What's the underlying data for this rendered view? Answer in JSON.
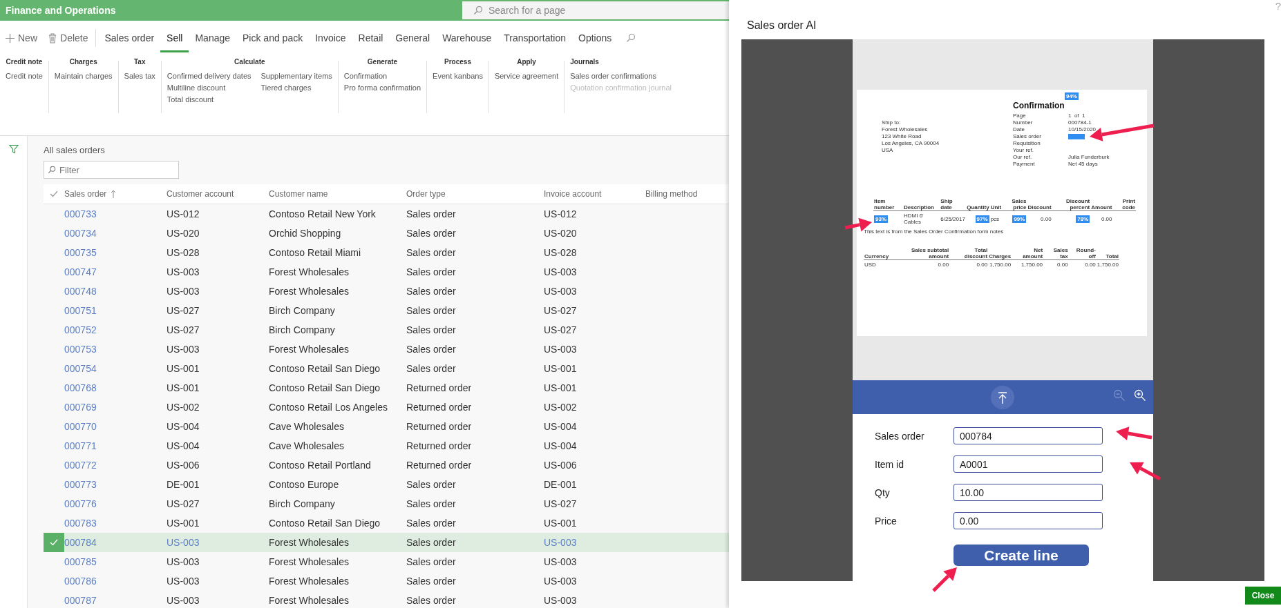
{
  "app": {
    "title": "Finance and Operations",
    "search_placeholder": "Search for a page"
  },
  "actions": [
    {
      "kind": "new",
      "label": "New"
    },
    {
      "kind": "delete",
      "label": "Delete"
    }
  ],
  "tabs": [
    {
      "label": "Sales order",
      "selected": false
    },
    {
      "label": "Sell",
      "selected": true
    },
    {
      "label": "Manage",
      "selected": false
    },
    {
      "label": "Pick and pack",
      "selected": false
    },
    {
      "label": "Invoice",
      "selected": false
    },
    {
      "label": "Retail",
      "selected": false
    },
    {
      "label": "General",
      "selected": false
    },
    {
      "label": "Warehouse",
      "selected": false
    },
    {
      "label": "Transportation",
      "selected": false
    },
    {
      "label": "Options",
      "selected": false
    }
  ],
  "ribbon": [
    {
      "title": "Credit note",
      "columns": [
        [
          {
            "label": "Credit note",
            "disabled": false
          }
        ]
      ]
    },
    {
      "title": "Charges",
      "columns": [
        [
          {
            "label": "Maintain charges",
            "disabled": false
          }
        ]
      ]
    },
    {
      "title": "Tax",
      "columns": [
        [
          {
            "label": "Sales tax",
            "disabled": false
          }
        ]
      ]
    },
    {
      "title": "Calculate",
      "columns": [
        [
          {
            "label": "Confirmed delivery dates",
            "disabled": false
          },
          {
            "label": "Multiline discount",
            "disabled": false
          },
          {
            "label": "Total discount",
            "disabled": false
          }
        ],
        [
          {
            "label": "Supplementary items",
            "disabled": false
          },
          {
            "label": "Tiered charges",
            "disabled": false
          }
        ]
      ]
    },
    {
      "title": "Generate",
      "columns": [
        [
          {
            "label": "Confirmation",
            "disabled": false
          },
          {
            "label": "Pro forma confirmation",
            "disabled": false
          }
        ]
      ]
    },
    {
      "title": "Process",
      "columns": [
        [
          {
            "label": "Event kanbans",
            "disabled": false
          }
        ]
      ]
    },
    {
      "title": "Apply",
      "columns": [
        [
          {
            "label": "Service agreement",
            "disabled": false
          }
        ]
      ]
    },
    {
      "title": "Journals",
      "columns": [
        [
          {
            "label": "Sales order confirmations",
            "disabled": false
          },
          {
            "label": "Quotation confirmation journal",
            "disabled": true
          }
        ]
      ]
    }
  ],
  "grid": {
    "title": "All sales orders",
    "filter_placeholder": "Filter",
    "columns": [
      "Sales order",
      "Customer account",
      "Customer name",
      "Order type",
      "Invoice account",
      "Billing method"
    ],
    "rows": [
      {
        "order": "000733",
        "account": "US-012",
        "name": "Contoso Retail New York",
        "type": "Sales order",
        "invoice": "US-012",
        "selected": false
      },
      {
        "order": "000734",
        "account": "US-020",
        "name": "Orchid Shopping",
        "type": "Sales order",
        "invoice": "US-020",
        "selected": false
      },
      {
        "order": "000735",
        "account": "US-028",
        "name": "Contoso Retail Miami",
        "type": "Sales order",
        "invoice": "US-028",
        "selected": false
      },
      {
        "order": "000747",
        "account": "US-003",
        "name": "Forest Wholesales",
        "type": "Sales order",
        "invoice": "US-003",
        "selected": false
      },
      {
        "order": "000748",
        "account": "US-003",
        "name": "Forest Wholesales",
        "type": "Sales order",
        "invoice": "US-003",
        "selected": false
      },
      {
        "order": "000751",
        "account": "US-027",
        "name": "Birch Company",
        "type": "Sales order",
        "invoice": "US-027",
        "selected": false
      },
      {
        "order": "000752",
        "account": "US-027",
        "name": "Birch Company",
        "type": "Sales order",
        "invoice": "US-027",
        "selected": false
      },
      {
        "order": "000753",
        "account": "US-003",
        "name": "Forest Wholesales",
        "type": "Sales order",
        "invoice": "US-003",
        "selected": false
      },
      {
        "order": "000754",
        "account": "US-001",
        "name": "Contoso Retail San Diego",
        "type": "Sales order",
        "invoice": "US-001",
        "selected": false
      },
      {
        "order": "000768",
        "account": "US-001",
        "name": "Contoso Retail San Diego",
        "type": "Returned order",
        "invoice": "US-001",
        "selected": false
      },
      {
        "order": "000769",
        "account": "US-002",
        "name": "Contoso Retail Los Angeles",
        "type": "Returned order",
        "invoice": "US-002",
        "selected": false
      },
      {
        "order": "000770",
        "account": "US-004",
        "name": "Cave Wholesales",
        "type": "Returned order",
        "invoice": "US-004",
        "selected": false
      },
      {
        "order": "000771",
        "account": "US-004",
        "name": "Cave Wholesales",
        "type": "Returned order",
        "invoice": "US-004",
        "selected": false
      },
      {
        "order": "000772",
        "account": "US-006",
        "name": "Contoso Retail Portland",
        "type": "Returned order",
        "invoice": "US-006",
        "selected": false
      },
      {
        "order": "000773",
        "account": "DE-001",
        "name": "Contoso Europe",
        "type": "Sales order",
        "invoice": "DE-001",
        "selected": false
      },
      {
        "order": "000776",
        "account": "US-027",
        "name": "Birch Company",
        "type": "Sales order",
        "invoice": "US-027",
        "selected": false
      },
      {
        "order": "000783",
        "account": "US-001",
        "name": "Contoso Retail San Diego",
        "type": "Sales order",
        "invoice": "US-001",
        "selected": false
      },
      {
        "order": "000784",
        "account": "US-003",
        "name": "Forest Wholesales",
        "type": "Sales order",
        "invoice": "US-003",
        "selected": true
      },
      {
        "order": "000785",
        "account": "US-003",
        "name": "Forest Wholesales",
        "type": "Sales order",
        "invoice": "US-003",
        "selected": false
      },
      {
        "order": "000786",
        "account": "US-003",
        "name": "Forest Wholesales",
        "type": "Sales order",
        "invoice": "US-003",
        "selected": false
      },
      {
        "order": "000787",
        "account": "US-003",
        "name": "Forest Wholesales",
        "type": "Sales order",
        "invoice": "US-003",
        "selected": false
      }
    ]
  },
  "panel": {
    "help": "?",
    "title": "Sales order AI",
    "document": {
      "badge": "94%",
      "title": "Confirmation",
      "ship_to": [
        "Ship to:",
        "Forest Wholesales",
        "123 White Road",
        "Los Angeles, CA 90004",
        "USA"
      ],
      "fields": [
        {
          "label": "Page",
          "value": "1  of  1",
          "highlighted": false
        },
        {
          "label": "Number",
          "value": "000784-1",
          "highlighted": false
        },
        {
          "label": "Date",
          "value": "10/15/2020",
          "highlighted": false
        },
        {
          "label": "Sales order",
          "highlighted": true
        },
        {
          "label": "Requisition",
          "highlighted": false
        },
        {
          "label": "Your ref.",
          "highlighted": false
        },
        {
          "label": "Our ref.",
          "value": "Julia Funderburk",
          "highlighted": false
        },
        {
          "label": "Payment",
          "value": "Net 45 days",
          "highlighted": false
        }
      ],
      "line_columns": [
        "Item number",
        "Description",
        "Ship date",
        "Quantity",
        "Unit",
        "Sales price",
        "Discount",
        "Discount percent",
        "Amount",
        "Print code"
      ],
      "line_cells": [
        {
          "score": "93%"
        },
        {
          "text": "HDMI 6' Cables"
        },
        {
          "text": "6/25/2017"
        },
        {
          "score": "97%"
        },
        {
          "text": "pcs"
        },
        {
          "score": "99%"
        },
        {
          "text": "0.00"
        },
        {
          "score": "78%"
        },
        {
          "text": "0.00"
        },
        {}
      ],
      "note": "This text is from the Sales Order Confirmation form notes",
      "total_columns": [
        "Currency",
        "Sales subtotal amount",
        "Total discount",
        "Charges",
        "Net amount",
        "Sales tax",
        "Round-off",
        "Total"
      ],
      "total_values": [
        "USD",
        "0.00",
        "0.00",
        "1,750.00",
        "1,750.00",
        "0.00",
        "0.00",
        "1,750.00"
      ]
    },
    "form": [
      {
        "label": "Sales order",
        "value": "000784"
      },
      {
        "label": "Item id",
        "value": "A0001"
      },
      {
        "label": "Qty",
        "value": "10.00"
      },
      {
        "label": "Price",
        "value": "0.00"
      }
    ],
    "create_button": "Create line",
    "close_button": "Close"
  }
}
